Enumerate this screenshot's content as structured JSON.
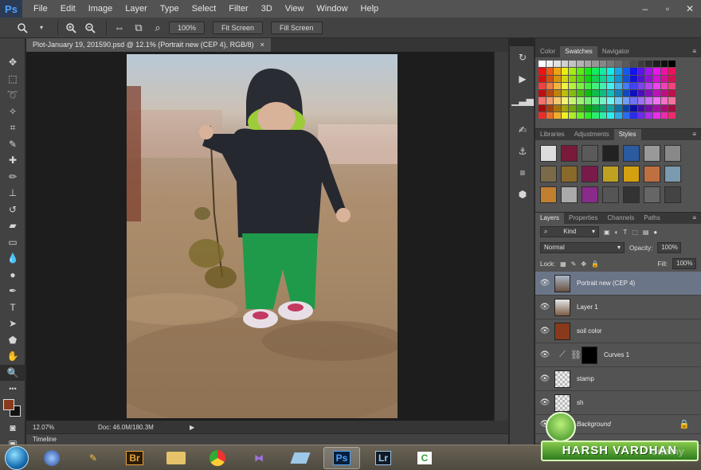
{
  "app": {
    "logo": "Ps",
    "menu": [
      "File",
      "Edit",
      "Image",
      "Layer",
      "Type",
      "Select",
      "Filter",
      "3D",
      "View",
      "Window",
      "Help"
    ],
    "window_controls": [
      "–",
      "▫",
      "✕"
    ]
  },
  "options_bar": {
    "zoom_100": "100%",
    "fit_screen": "Fit Screen",
    "fill_screen": "Fill Screen"
  },
  "document": {
    "tab_title": "Plot-January 19, 201590.psd @ 12.1% (Portrait new (CEP 4), RGB/8)",
    "tab_close": "×",
    "zoom": "12.07%",
    "doc_info": "Doc: 46.0M/180.3M",
    "timeline": "Timeline"
  },
  "panels": {
    "top_tabs": [
      "Color",
      "Swatches",
      "Navigator"
    ],
    "top_active": "Swatches",
    "mid_tabs": [
      "Libraries",
      "Adjustments",
      "Styles"
    ],
    "mid_active": "Styles",
    "layers_tabs": [
      "Layers",
      "Properties",
      "Channels",
      "Paths"
    ],
    "layers_active": "Layers",
    "kind_label": "Kind",
    "blend_mode": "Normal",
    "opacity_label": "Opacity:",
    "opacity_value": "100%",
    "lock_label": "Lock:",
    "fill_label": "Fill:",
    "fill_value": "100%",
    "layers": [
      {
        "name": "Portrait new (CEP 4)",
        "selected": true
      },
      {
        "name": "Layer 1",
        "selected": false
      },
      {
        "name": "soil color",
        "selected": false
      },
      {
        "name": "Curves 1",
        "selected": false
      },
      {
        "name": "stamp",
        "selected": false
      },
      {
        "name": "sh",
        "selected": false
      },
      {
        "name": "Background",
        "selected": false
      }
    ]
  },
  "colors": {
    "foreground": "#8a3a1c",
    "background": "#111111",
    "selected_layer": "#6b7588"
  },
  "taskbar": {
    "apps": [
      "Br",
      "Ps",
      "Lr"
    ]
  },
  "watermark": {
    "text": "HARSH VARDHAN",
    "faded_text": "udemy"
  }
}
